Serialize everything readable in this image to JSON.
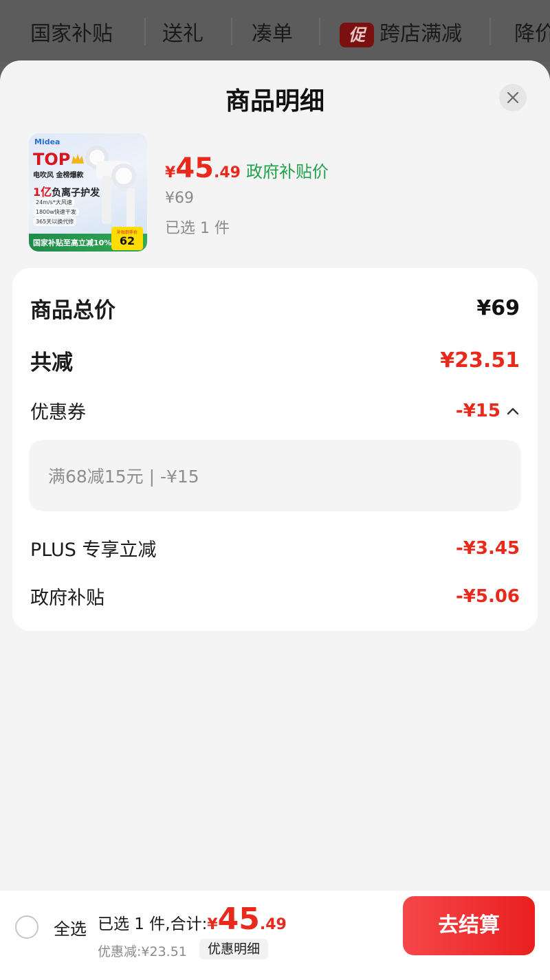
{
  "top_tabs": [
    {
      "label": "国家补贴"
    },
    {
      "label": "送礼"
    },
    {
      "label": "凑单"
    },
    {
      "label": "跨店满减",
      "badge": "促"
    },
    {
      "label": "降价"
    }
  ],
  "sheet": {
    "title": "商品明细"
  },
  "product": {
    "image": {
      "brand": "Midea",
      "headline": "TOP",
      "line1": "电吹风 金榜爆款",
      "line2_num": "1亿",
      "line2_text": "负离子护发",
      "features": [
        "24m/s*大风速",
        "1800w快速干发",
        "365天以换代修"
      ],
      "bottom_banner": "国家补贴至高立减10%",
      "price_box_label": "补贴到手价",
      "price_box_value": "62"
    },
    "price_currency": "¥",
    "price_int": "45",
    "price_dec": ".49",
    "price_tag": "政府补贴价",
    "original_price": "¥69",
    "selected_count": "已选 1 件"
  },
  "breakdown": {
    "total_label": "商品总价",
    "total_value": "¥69",
    "reduce_label": "共减",
    "reduce_value": "¥23.51",
    "coupon_label": "优惠券",
    "coupon_value": "-¥15",
    "coupon_detail": "满68减15元 | -¥15",
    "plus_label": "PLUS 专享立减",
    "plus_value": "-¥3.45",
    "gov_label": "政府补贴",
    "gov_value": "-¥5.06"
  },
  "bottom": {
    "select_all": "全选",
    "summary_text": "已选 1 件,合计:",
    "total_currency": "¥",
    "total_int": "45",
    "total_dec": ".49",
    "discount_text": "优惠减:¥23.51",
    "detail_link": "优惠明细",
    "checkout": "去结算"
  },
  "colors": {
    "accent_red": "#e8291c",
    "subsidy_green": "#1fa24a"
  }
}
